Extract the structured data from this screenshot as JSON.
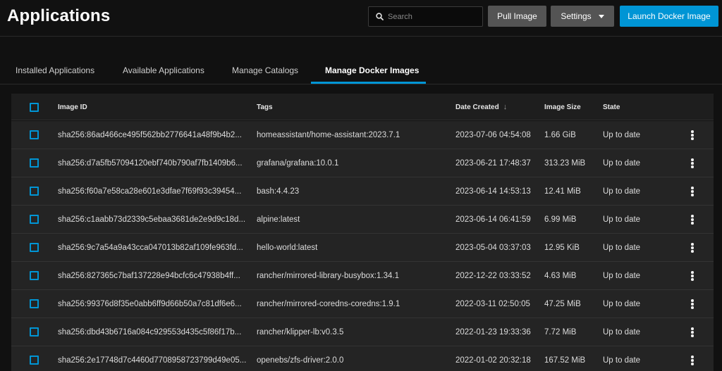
{
  "page": {
    "title": "Applications"
  },
  "header": {
    "search": {
      "placeholder": "Search",
      "icon": "search-icon"
    },
    "pull_image_label": "Pull Image",
    "settings_label": "Settings",
    "launch_label": "Launch Docker Image"
  },
  "tabs": [
    {
      "label": "Installed Applications",
      "active": false
    },
    {
      "label": "Available Applications",
      "active": false
    },
    {
      "label": "Manage Catalogs",
      "active": false
    },
    {
      "label": "Manage Docker Images",
      "active": true
    }
  ],
  "table": {
    "columns": [
      "Image ID",
      "Tags",
      "Date Created",
      "Image Size",
      "State"
    ],
    "sort_column": "Date Created",
    "sort_direction": "desc",
    "rows": [
      {
        "id": "sha256:86ad466ce495f562bb2776641a48f9b4b2...",
        "tags": "homeassistant/home-assistant:2023.7.1",
        "date": "2023-07-06 04:54:08",
        "size": "1.66 GiB",
        "state": "Up to date"
      },
      {
        "id": "sha256:d7a5fb57094120ebf740b790af7fb1409b6...",
        "tags": "grafana/grafana:10.0.1",
        "date": "2023-06-21 17:48:37",
        "size": "313.23 MiB",
        "state": "Up to date"
      },
      {
        "id": "sha256:f60a7e58ca28e601e3dfae7f69f93c39454...",
        "tags": "bash:4.4.23",
        "date": "2023-06-14 14:53:13",
        "size": "12.41 MiB",
        "state": "Up to date"
      },
      {
        "id": "sha256:c1aabb73d2339c5ebaa3681de2e9d9c18d...",
        "tags": "alpine:latest",
        "date": "2023-06-14 06:41:59",
        "size": "6.99 MiB",
        "state": "Up to date"
      },
      {
        "id": "sha256:9c7a54a9a43cca047013b82af109fe963fd...",
        "tags": "hello-world:latest",
        "date": "2023-05-04 03:37:03",
        "size": "12.95 KiB",
        "state": "Up to date"
      },
      {
        "id": "sha256:827365c7baf137228e94bcfc6c47938b4ff...",
        "tags": "rancher/mirrored-library-busybox:1.34.1",
        "date": "2022-12-22 03:33:52",
        "size": "4.63 MiB",
        "state": "Up to date"
      },
      {
        "id": "sha256:99376d8f35e0abb6ff9d66b50a7c81df6e6...",
        "tags": "rancher/mirrored-coredns-coredns:1.9.1",
        "date": "2022-03-11 02:50:05",
        "size": "47.25 MiB",
        "state": "Up to date"
      },
      {
        "id": "sha256:dbd43b6716a084c929553d435c5f86f17b...",
        "tags": "rancher/klipper-lb:v0.3.5",
        "date": "2022-01-23 19:33:36",
        "size": "7.72 MiB",
        "state": "Up to date"
      },
      {
        "id": "sha256:2e17748d7c4460d7708958723799d49e05...",
        "tags": "openebs/zfs-driver:2.0.0",
        "date": "2022-01-02 20:32:18",
        "size": "167.52 MiB",
        "state": "Up to date"
      }
    ]
  },
  "colors": {
    "accent": "#0095d5",
    "background": "#111111",
    "row": "#242424",
    "button_gray": "#545454"
  }
}
